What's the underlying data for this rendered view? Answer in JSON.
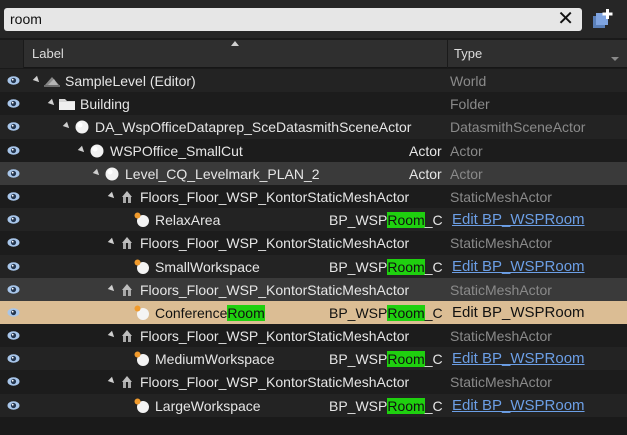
{
  "search": {
    "value": "room"
  },
  "header": {
    "label_col": "Label",
    "type_col": "Type"
  },
  "match_term": "Room",
  "rows": [
    {
      "label": "SampleLevel (Editor)",
      "type": "World",
      "icon": "world-icon",
      "depth": 0
    },
    {
      "label": "Building",
      "type": "Folder",
      "icon": "folder-icon",
      "depth": 1
    },
    {
      "label": "DA_WspOfficeDataprep_SceDatasmithSceneActor",
      "type": "DatasmithSceneActor",
      "icon": "actor-sphere-icon",
      "depth": 2
    },
    {
      "label": "WSPOffice_SmallCut",
      "class_label": "Actor",
      "type": "Actor",
      "icon": "actor-sphere-icon",
      "depth": 3
    },
    {
      "label": "Level_CQ_Levelmark_PLAN_2",
      "class_label": "Actor",
      "type": "Actor",
      "icon": "actor-sphere-icon",
      "depth": 4
    },
    {
      "label": "Floors_Floor_WSP_KontorStaticMeshActor",
      "type": "StaticMeshActor",
      "icon": "static-mesh-icon",
      "depth": 5
    },
    {
      "label": "RelaxArea",
      "class_pre": "BP_WSP",
      "class_hl": "Room",
      "class_post": "_C",
      "type": "Edit BP_WSPRoom",
      "icon": "blueprint-actor-icon",
      "depth": 6
    },
    {
      "label": "Floors_Floor_WSP_KontorStaticMeshActor",
      "type": "StaticMeshActor",
      "icon": "static-mesh-icon",
      "depth": 5
    },
    {
      "label": "SmallWorkspace",
      "class_pre": "BP_WSP",
      "class_hl": "Room",
      "class_post": "_C",
      "type": "Edit BP_WSPRoom",
      "icon": "blueprint-actor-icon",
      "depth": 6
    },
    {
      "label": "Floors_Floor_WSP_KontorStaticMeshActor",
      "type": "StaticMeshActor",
      "icon": "static-mesh-icon",
      "depth": 5
    },
    {
      "label_pre": "Conference",
      "label_hl": "Room",
      "class_pre": "BP_WSP",
      "class_hl": "Room",
      "class_post": "_C",
      "type": "Edit BP_WSPRoom",
      "icon": "blueprint-actor-icon",
      "depth": 6,
      "selected": true
    },
    {
      "label": "Floors_Floor_WSP_KontorStaticMeshActor",
      "type": "StaticMeshActor",
      "icon": "static-mesh-icon",
      "depth": 5
    },
    {
      "label": "MediumWorkspace",
      "class_pre": "BP_WSP",
      "class_hl": "Room",
      "class_post": "_C",
      "type": "Edit BP_WSPRoom",
      "icon": "blueprint-actor-icon",
      "depth": 6
    },
    {
      "label": "Floors_Floor_WSP_KontorStaticMeshActor",
      "type": "StaticMeshActor",
      "icon": "static-mesh-icon",
      "depth": 5
    },
    {
      "label": "LargeWorkspace",
      "class_pre": "BP_WSP",
      "class_hl": "Room",
      "class_post": "_C",
      "type": "Edit BP_WSPRoom",
      "icon": "blueprint-actor-icon",
      "depth": 6
    }
  ],
  "colors": {
    "highlight": "#1fd00f",
    "selection": "#dbbd94",
    "link": "#6c9fe6",
    "type_text": "#8a8a8a"
  }
}
